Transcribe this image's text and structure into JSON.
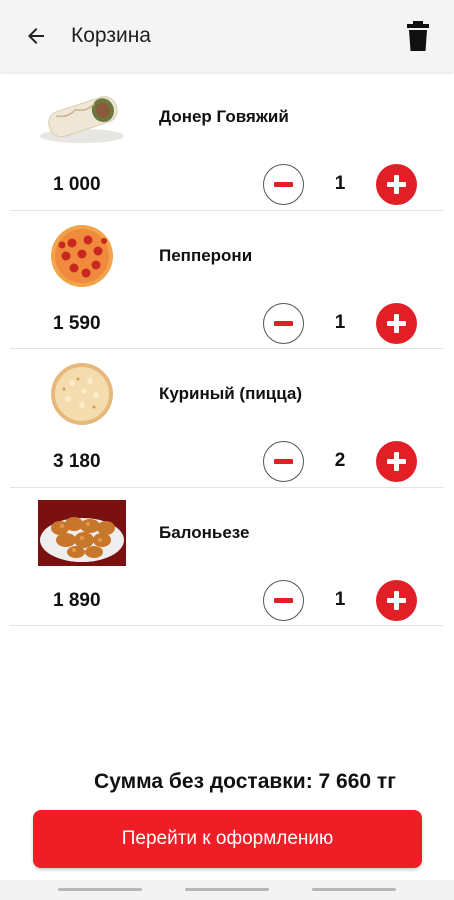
{
  "header": {
    "title": "Корзина",
    "back_icon": "arrow-left-icon",
    "trash_icon": "trash-icon"
  },
  "items": [
    {
      "name": "Донер Говяжий",
      "price": "1 000",
      "qty": "1",
      "image": "doner-wrap-image"
    },
    {
      "name": "Пепперони",
      "price": "1 590",
      "qty": "1",
      "image": "pepperoni-pizza-image"
    },
    {
      "name": "Куриный (пицца)",
      "price": "3 180",
      "qty": "2",
      "image": "chicken-pizza-image"
    },
    {
      "name": "Балоньезе",
      "price": "1 890",
      "qty": "1",
      "image": "fried-chicken-image"
    }
  ],
  "summary": {
    "total_text": "Сумма без доставки: 7 660 тг"
  },
  "checkout": {
    "label": "Перейти к оформлению"
  },
  "colors": {
    "accent": "#e21f26",
    "appbar": "#f4f4f4"
  }
}
